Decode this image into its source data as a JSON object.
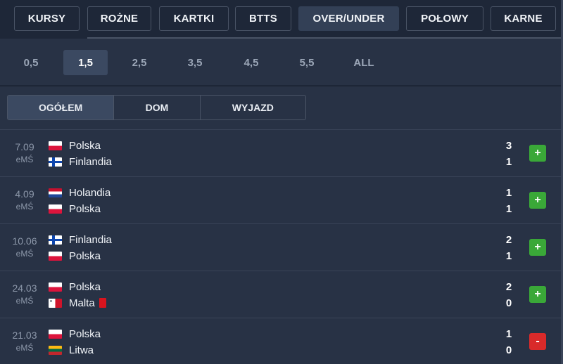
{
  "top_tabs": [
    {
      "label": "KURSY",
      "active": false
    },
    {
      "label": "ROŻNE",
      "active": false
    },
    {
      "label": "KARTKI",
      "active": false
    },
    {
      "label": "BTTS",
      "active": false
    },
    {
      "label": "OVER/UNDER",
      "active": true
    },
    {
      "label": "POŁOWY",
      "active": false
    },
    {
      "label": "KARNE",
      "active": false
    }
  ],
  "lines": [
    {
      "label": "0,5",
      "active": false
    },
    {
      "label": "1,5",
      "active": true
    },
    {
      "label": "2,5",
      "active": false
    },
    {
      "label": "3,5",
      "active": false
    },
    {
      "label": "4,5",
      "active": false
    },
    {
      "label": "5,5",
      "active": false
    },
    {
      "label": "ALL",
      "active": false
    }
  ],
  "filters": [
    {
      "label": "OGÓŁEM",
      "active": true
    },
    {
      "label": "DOM",
      "active": false
    },
    {
      "label": "WYJAZD",
      "active": false
    }
  ],
  "matches": [
    {
      "date": "7.09",
      "competition": "eMŚ",
      "home": {
        "name": "Polska",
        "flag": "flag-poland-icon",
        "red_cards": 0
      },
      "away": {
        "name": "Finlandia",
        "flag": "flag-finland-icon",
        "red_cards": 0
      },
      "score_home": "3",
      "score_away": "1",
      "result": "+",
      "result_type": "win"
    },
    {
      "date": "4.09",
      "competition": "eMŚ",
      "home": {
        "name": "Holandia",
        "flag": "flag-netherlands-icon",
        "red_cards": 0
      },
      "away": {
        "name": "Polska",
        "flag": "flag-poland-icon",
        "red_cards": 0
      },
      "score_home": "1",
      "score_away": "1",
      "result": "+",
      "result_type": "win"
    },
    {
      "date": "10.06",
      "competition": "eMŚ",
      "home": {
        "name": "Finlandia",
        "flag": "flag-finland-icon",
        "red_cards": 0
      },
      "away": {
        "name": "Polska",
        "flag": "flag-poland-icon",
        "red_cards": 0
      },
      "score_home": "2",
      "score_away": "1",
      "result": "+",
      "result_type": "win"
    },
    {
      "date": "24.03",
      "competition": "eMŚ",
      "home": {
        "name": "Polska",
        "flag": "flag-poland-icon",
        "red_cards": 0
      },
      "away": {
        "name": "Malta",
        "flag": "flag-malta-icon",
        "red_cards": 1
      },
      "score_home": "2",
      "score_away": "0",
      "result": "+",
      "result_type": "win"
    },
    {
      "date": "21.03",
      "competition": "eMŚ",
      "home": {
        "name": "Polska",
        "flag": "flag-poland-icon",
        "red_cards": 0
      },
      "away": {
        "name": "Litwa",
        "flag": "flag-lithuania-icon",
        "red_cards": 0
      },
      "score_home": "1",
      "score_away": "0",
      "result": "-",
      "result_type": "loss"
    }
  ],
  "colors": {
    "background": "#1e2738",
    "panel": "#283245",
    "active_tab": "#334056",
    "win": "#3aa838",
    "loss": "#d92a2a"
  }
}
